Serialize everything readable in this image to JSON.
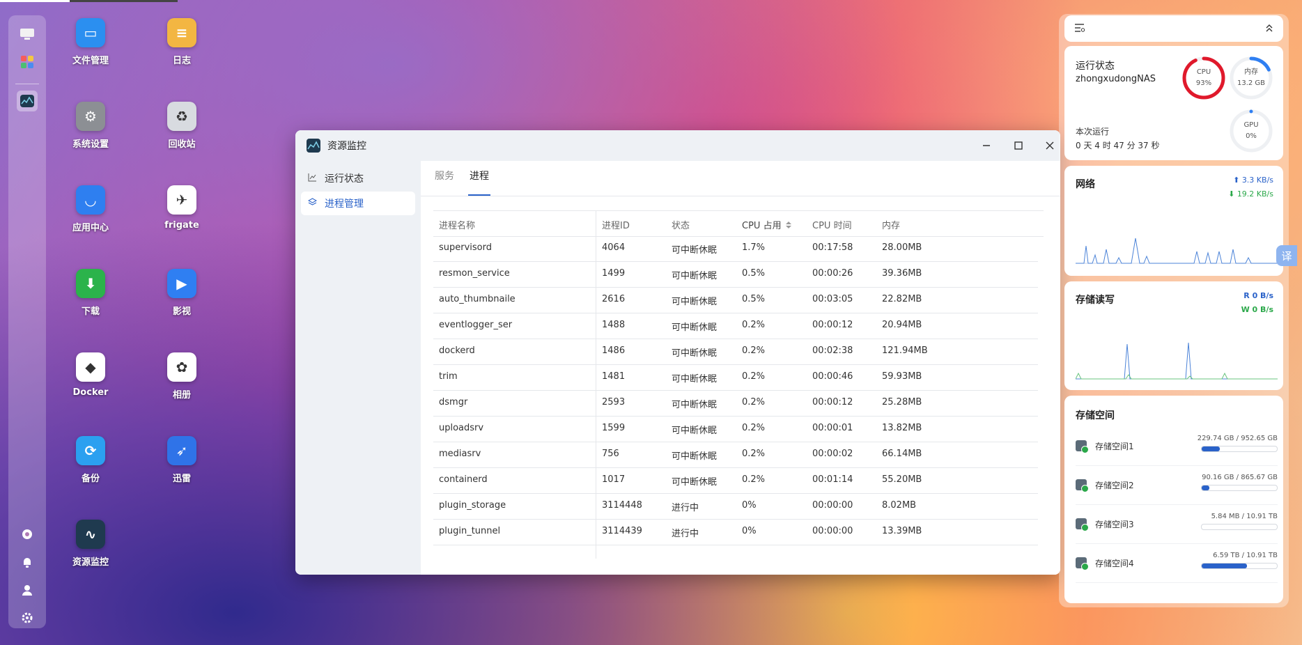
{
  "desktop": {
    "apps": [
      {
        "label": "文件管理",
        "color": "#2b8ff0",
        "glyph": "▭"
      },
      {
        "label": "日志",
        "color": "#f3b642",
        "glyph": "≡"
      },
      {
        "label": "系统设置",
        "color": "#8c8f94",
        "glyph": "⚙"
      },
      {
        "label": "回收站",
        "color": "#d8dbe0",
        "glyph": "♻"
      },
      {
        "label": "应用中心",
        "color": "#2e7ff0",
        "glyph": "◡"
      },
      {
        "label": "frigate",
        "color": "#ffffff",
        "glyph": "✈"
      },
      {
        "label": "下载",
        "color": "#2bb34b",
        "glyph": "⬇"
      },
      {
        "label": "影视",
        "color": "#2f7ff2",
        "glyph": "▶"
      },
      {
        "label": "Docker",
        "color": "#ffffff",
        "glyph": "◆"
      },
      {
        "label": "相册",
        "color": "#ffffff",
        "glyph": "✿"
      },
      {
        "label": "备份",
        "color": "#2ba0f0",
        "glyph": "⟳"
      },
      {
        "label": "迅雷",
        "color": "#2f73e8",
        "glyph": "➶"
      },
      {
        "label": "资源监控",
        "color": "#1f3a4f",
        "glyph": "∿"
      }
    ]
  },
  "window": {
    "title": "资源监控",
    "nav": [
      {
        "label": "运行状态",
        "icon": "chart-line-icon"
      },
      {
        "label": "进程管理",
        "icon": "layers-icon"
      }
    ],
    "tabs": [
      {
        "label": "服务"
      },
      {
        "label": "进程"
      }
    ],
    "columns": [
      "进程名称",
      "进程ID",
      "状态",
      "CPU 占用",
      "CPU 时间",
      "内存"
    ],
    "rows": [
      [
        "supervisord",
        "4064",
        "可中断休眠",
        "1.7%",
        "00:17:58",
        "28.00MB"
      ],
      [
        "resmon_service",
        "1499",
        "可中断休眠",
        "0.5%",
        "00:00:26",
        "39.36MB"
      ],
      [
        "auto_thumbnaile",
        "2616",
        "可中断休眠",
        "0.5%",
        "00:03:05",
        "22.82MB"
      ],
      [
        "eventlogger_ser",
        "1488",
        "可中断休眠",
        "0.2%",
        "00:00:12",
        "20.94MB"
      ],
      [
        "dockerd",
        "1486",
        "可中断休眠",
        "0.2%",
        "00:02:38",
        "121.94MB"
      ],
      [
        "trim",
        "1481",
        "可中断休眠",
        "0.2%",
        "00:00:46",
        "59.93MB"
      ],
      [
        "dsmgr",
        "2593",
        "可中断休眠",
        "0.2%",
        "00:00:12",
        "25.28MB"
      ],
      [
        "uploadsrv",
        "1599",
        "可中断休眠",
        "0.2%",
        "00:00:01",
        "13.82MB"
      ],
      [
        "mediasrv",
        "756",
        "可中断休眠",
        "0.2%",
        "00:00:02",
        "66.14MB"
      ],
      [
        "containerd",
        "1017",
        "可中断休眠",
        "0.2%",
        "00:01:14",
        "55.20MB"
      ],
      [
        "plugin_storage",
        "3114448",
        "进行中",
        "0%",
        "00:00:00",
        "8.02MB"
      ],
      [
        "plugin_tunnel",
        "3114439",
        "进行中",
        "0%",
        "00:00:00",
        "13.39MB"
      ]
    ]
  },
  "widgets": {
    "status": {
      "title": "运行状态",
      "host": "zhongxudongNAS",
      "uptime_label": "本次运行",
      "uptime": "0 天 4 时 47 分 37 秒",
      "cpu": {
        "label": "CPU",
        "value": "93%",
        "fraction": 0.93
      },
      "mem": {
        "label": "内存",
        "value": "13.2 GB",
        "fraction": 0.18
      },
      "gpu": {
        "label": "GPU",
        "value": "0%",
        "fraction": 0
      }
    },
    "network": {
      "title": "网络",
      "up": "3.3 KB/s",
      "down": "19.2 KB/s"
    },
    "disk_io": {
      "title": "存储读写",
      "read": "R  0 B/s",
      "write": "W  0 B/s"
    },
    "storage": {
      "title": "存储空间",
      "items": [
        {
          "name": "存储空间1",
          "usage": "229.74 GB / 952.65 GB",
          "fraction": 0.24
        },
        {
          "name": "存储空间2",
          "usage": "90.16 GB / 865.67 GB",
          "fraction": 0.1
        },
        {
          "name": "存储空间3",
          "usage": "5.84 MB / 10.91 TB",
          "fraction": 0.0
        },
        {
          "name": "存储空间4",
          "usage": "6.59 TB / 10.91 TB",
          "fraction": 0.6
        }
      ]
    }
  },
  "translate_button": "译",
  "colors": {
    "accent": "#2a62c9",
    "cpu_ring": "#e0192b",
    "mem_ring": "#2f7ff2",
    "up": "#2a62c9",
    "down": "#2ba84a"
  }
}
